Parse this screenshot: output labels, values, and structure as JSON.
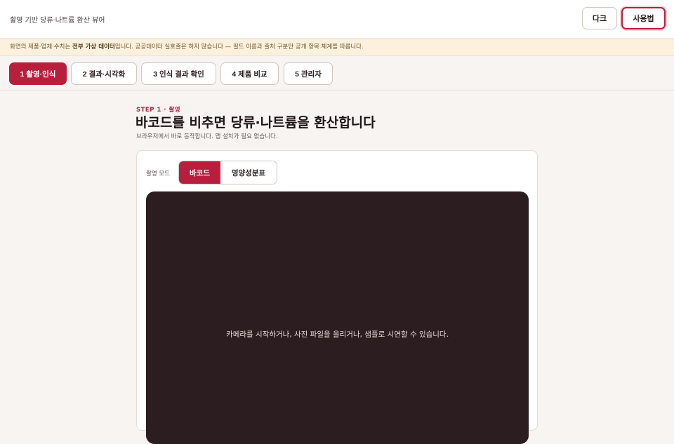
{
  "header": {
    "title": "촬영 기반 당류·나트륨 환산 뷰어",
    "dark_label": "다크",
    "help_label": "사용법"
  },
  "notice": {
    "prefix": "화면의 제품·업체·수치는 ",
    "bold": "전부 가상 데이터",
    "suffix": "입니다. 공공데이터 실호출은 하지 않습니다 — 필드 이름과 출처 구분만 공개 항목 체계를 따릅니다."
  },
  "steps": [
    {
      "label": "1 촬영·인식",
      "active": true
    },
    {
      "label": "2 결과·시각화",
      "active": false
    },
    {
      "label": "3 인식 결과 확인",
      "active": false
    },
    {
      "label": "4 제품 비교",
      "active": false
    },
    {
      "label": "5 관리자",
      "active": false
    }
  ],
  "main": {
    "eyebrow": "STEP 1 · 촬영",
    "heading": "바코드를 비추면 당류·나트륨을 환산합니다",
    "description": "브라우저에서 바로 동작합니다. 앱 설치가 필요 없습니다.",
    "mode_label": "촬영 모드",
    "modes": [
      {
        "label": "바코드",
        "active": true
      },
      {
        "label": "영양성분표",
        "active": false
      }
    ],
    "viewer_message": "카메라를 시작하거나, 사진 파일을 올리거나, 샘플로 시연할 수 있습니다."
  },
  "colors": {
    "accent": "#b81f3d",
    "notice_bg": "#fdf1dd",
    "viewer_bg": "#2c1e20"
  }
}
